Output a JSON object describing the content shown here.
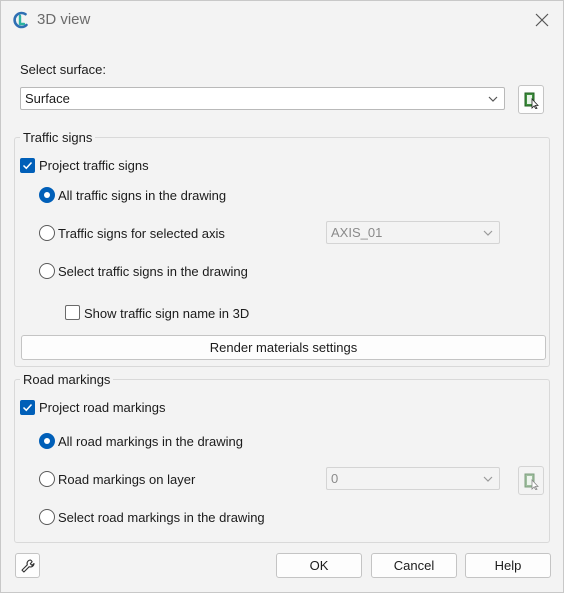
{
  "window": {
    "title": "3D view",
    "accent_color": "#005fb8"
  },
  "surface": {
    "label": "Select surface:",
    "value": "Surface"
  },
  "traffic_signs": {
    "group_title": "Traffic signs",
    "project_label": "Project traffic signs",
    "project_checked": true,
    "option_all": "All traffic signs in the drawing",
    "option_axis": "Traffic signs for selected axis",
    "axis_value": "AXIS_01",
    "option_select": "Select traffic signs in the drawing",
    "selected_option": "all",
    "show_name_label": "Show traffic sign name in 3D",
    "show_name_checked": false,
    "render_button": "Render materials settings"
  },
  "road_markings": {
    "group_title": "Road markings",
    "project_label": "Project road markings",
    "project_checked": true,
    "option_all": "All road markings in the drawing",
    "option_layer": "Road markings on layer",
    "layer_value": "0",
    "option_select": "Select road markings in the drawing",
    "selected_option": "all"
  },
  "footer": {
    "ok": "OK",
    "cancel": "Cancel",
    "help": "Help"
  },
  "icons": {
    "app": "app-logo-icon",
    "close": "close-icon",
    "pick": "pick-from-drawing-icon",
    "settings": "wrench-icon",
    "dropdown": "chevron-down-icon",
    "check": "checkmark-icon"
  }
}
